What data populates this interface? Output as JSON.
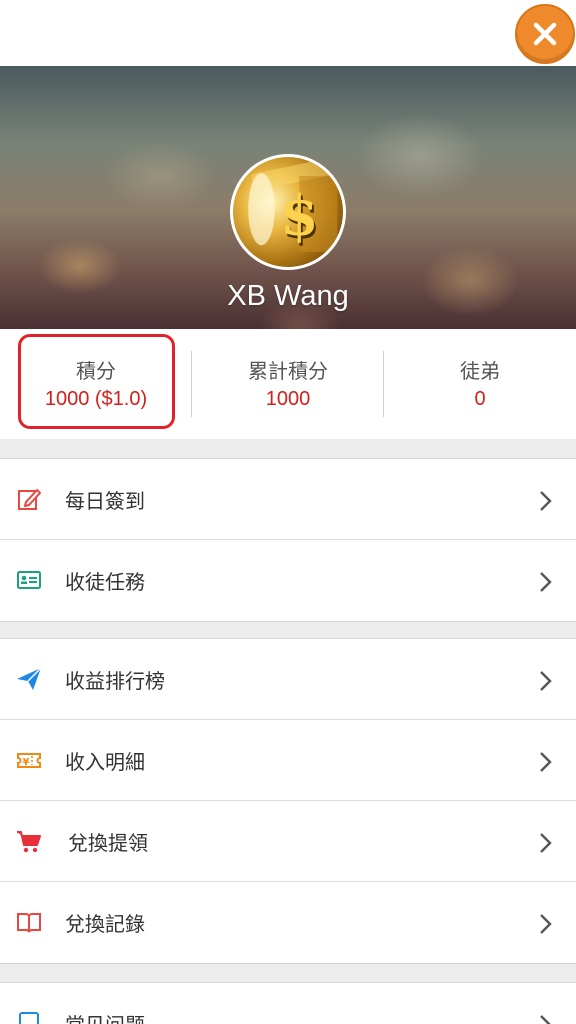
{
  "profile": {
    "name": "XB Wang"
  },
  "stats": [
    {
      "label": "積分",
      "value": "1000 ($1.0)"
    },
    {
      "label": "累計積分",
      "value": "1000"
    },
    {
      "label": "徒弟",
      "value": "0"
    }
  ],
  "menu_group1": [
    {
      "label": "每日簽到",
      "icon": "edit-icon",
      "color": "#e9473f"
    },
    {
      "label": "收徒任務",
      "icon": "id-card-icon",
      "color": "#1aa37a"
    }
  ],
  "menu_group2": [
    {
      "label": "收益排行榜",
      "icon": "paper-plane-icon",
      "color": "#1e88e5"
    },
    {
      "label": "收入明細",
      "icon": "ticket-icon",
      "color": "#f08a12"
    },
    {
      "label": "兌換提領",
      "icon": "cart-icon",
      "color": "#e8303a"
    },
    {
      "label": "兌換記錄",
      "icon": "book-icon",
      "color": "#e9473f"
    }
  ],
  "menu_group3": [
    {
      "label": "常见问题",
      "icon": "question-icon",
      "color": "#1e88e5"
    }
  ],
  "colors": {
    "accent_red": "#d3201a",
    "close_orange": "#ee8a2b"
  }
}
